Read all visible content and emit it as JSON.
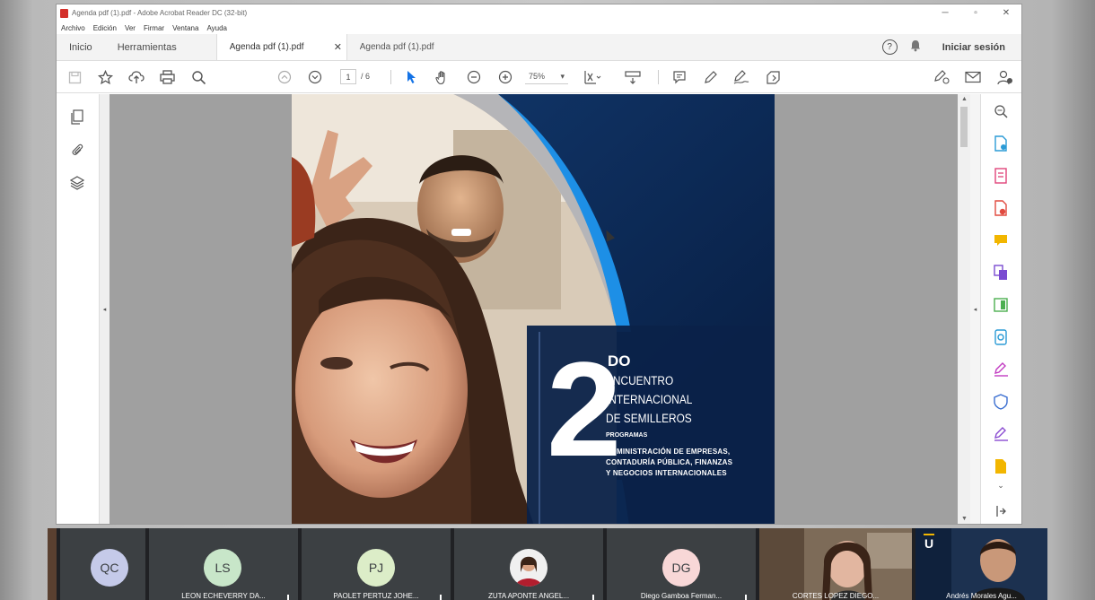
{
  "window": {
    "title": "Agenda pdf (1).pdf - Adobe Acrobat Reader DC (32-bit)",
    "minimize": "─",
    "restore": "▫",
    "close": "✕"
  },
  "menu": [
    "Archivo",
    "Edición",
    "Ver",
    "Firmar",
    "Ventana",
    "Ayuda"
  ],
  "tabs": {
    "home": "Inicio",
    "tools": "Herramientas",
    "documents": [
      {
        "label": "Agenda pdf (1).pdf",
        "close": "✕"
      },
      {
        "label": "Agenda pdf (1).pdf"
      }
    ],
    "sign_in": "Iniciar sesión",
    "help_glyph": "?",
    "bell_glyph": "🔔"
  },
  "toolbar": {
    "page_current": "1",
    "page_total": "/ 6",
    "zoom": "75%",
    "zoom_arrow": "▾",
    "icons": [
      "save-icon",
      "bookmark-star-icon",
      "upload-cloud-icon",
      "print-icon",
      "search-zoom-icon",
      "previous-page-icon",
      "next-page-icon",
      "select-cursor-icon",
      "hand-icon",
      "zoom-out-icon",
      "zoom-in-icon",
      "fit-page-icon",
      "scroll-mode-icon",
      "comment-icon",
      "pen-icon",
      "sign-icon",
      "more-tools-icon",
      "share-sign-icon",
      "email-icon",
      "user-add-icon"
    ]
  },
  "panels": {
    "left_collapse": "◂",
    "right_collapse": "◂",
    "left_icons": [
      "pages-icon",
      "attachment-icon",
      "layers-icon"
    ],
    "right_icons": [
      {
        "name": "zoom-panel-icon",
        "color": "#555555"
      },
      {
        "name": "export-pdf-icon",
        "color": "#2b9bd6"
      },
      {
        "name": "create-pdf-icon",
        "color": "#e0457b"
      },
      {
        "name": "edit-pdf-icon",
        "color": "#e04a3f"
      },
      {
        "name": "comment-panel-icon",
        "color": "#f2b600"
      },
      {
        "name": "combine-files-icon",
        "color": "#7a4bd1"
      },
      {
        "name": "organize-pages-icon",
        "color": "#4caf50"
      },
      {
        "name": "compress-pdf-icon",
        "color": "#2b9bd6"
      },
      {
        "name": "fill-sign-icon",
        "color": "#c23bc2"
      },
      {
        "name": "protect-icon",
        "color": "#3b6fd1"
      },
      {
        "name": "send-sign-icon",
        "color": "#8a4bd1"
      },
      {
        "name": "more-panel-icon",
        "color": "#f2b600"
      },
      {
        "name": "expand-panel-icon",
        "color": "#555555"
      },
      {
        "name": "collapse-panel-icon",
        "color": "#555555"
      }
    ]
  },
  "document": {
    "number": "2",
    "ordinal": "DO",
    "event_lines": [
      "ENCUENTRO",
      "INTERNACIONAL",
      "DE SEMILLEROS"
    ],
    "programs_label": "PROGRAMAS",
    "programs": [
      "ADMINISTRACIÓN DE EMPRESAS,",
      "CONTADURÍA PÚBLICA, FINANZAS",
      "Y  NEGOCIOS INTERNACIONALES"
    ],
    "colors": {
      "navy": "#0a2046",
      "blue_arc": "#1d8fe6",
      "gray_arc": "#b5b5b8"
    }
  },
  "participants": [
    {
      "initials": "QC",
      "name": "",
      "color": "#c5cae9"
    },
    {
      "initials": "LS",
      "name": "LEON ECHEVERRY DA...",
      "color": "#c8e6c9"
    },
    {
      "initials": "PJ",
      "name": "PAOLET PERTUZ JOHE...",
      "color": "#dcedc8"
    },
    {
      "initials": "",
      "name": "ZUTA APONTE ANGEL...",
      "color": "#f0f0f0"
    },
    {
      "initials": "DG",
      "name": "Diego Gamboa Ferman...",
      "color": "#f8d7d7"
    },
    {
      "initials": "",
      "name": "CORTES LOPEZ DIEGO...",
      "color": ""
    },
    {
      "initials": "",
      "name": "Andrés Morales Agu...",
      "color": ""
    }
  ]
}
